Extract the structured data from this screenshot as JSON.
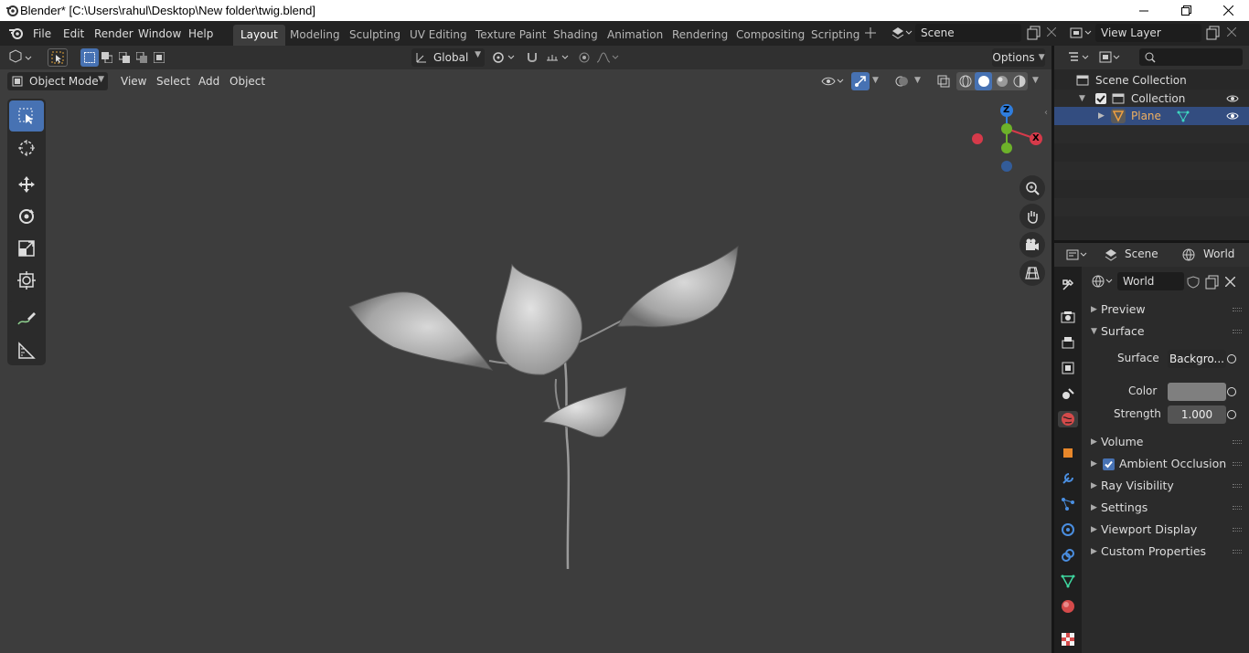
{
  "window": {
    "title": "Blender* [C:\\Users\\rahul\\Desktop\\New folder\\twig.blend]"
  },
  "menus": [
    "File",
    "Edit",
    "Render",
    "Window",
    "Help"
  ],
  "workspaces": [
    {
      "label": "Layout",
      "active": true
    },
    {
      "label": "Modeling"
    },
    {
      "label": "Sculpting"
    },
    {
      "label": "UV Editing"
    },
    {
      "label": "Texture Paint"
    },
    {
      "label": "Shading"
    },
    {
      "label": "Animation"
    },
    {
      "label": "Rendering"
    },
    {
      "label": "Compositing"
    },
    {
      "label": "Scripting"
    }
  ],
  "scene": {
    "name": "Scene"
  },
  "view_layer": {
    "name": "View Layer"
  },
  "viewport": {
    "transform_orientation": "Global",
    "options_label": "Options",
    "mode": "Object Mode",
    "header_menus": [
      "View",
      "Select",
      "Add",
      "Object"
    ]
  },
  "gizmo": {
    "z": "Z",
    "y": "Y",
    "x": "X"
  },
  "outliner": {
    "root": "Scene Collection",
    "collection": "Collection",
    "object": "Plane"
  },
  "properties": {
    "tabs": {
      "scene": "Scene",
      "world": "World"
    },
    "world_name": "World",
    "sections": {
      "preview": "Preview",
      "surface": "Surface",
      "volume": "Volume",
      "ambient_occlusion": "Ambient Occlusion",
      "ray_visibility": "Ray Visibility",
      "settings": "Settings",
      "viewport_display": "Viewport Display",
      "custom_properties": "Custom Properties"
    },
    "surface": {
      "surface_label": "Surface",
      "surface_value": "Backgro...",
      "color_label": "Color",
      "strength_label": "Strength",
      "strength_value": "1.000"
    }
  },
  "colors": {
    "accent": "#4772b3",
    "background": "#3d3d3d",
    "panel": "#2b2b2b"
  }
}
